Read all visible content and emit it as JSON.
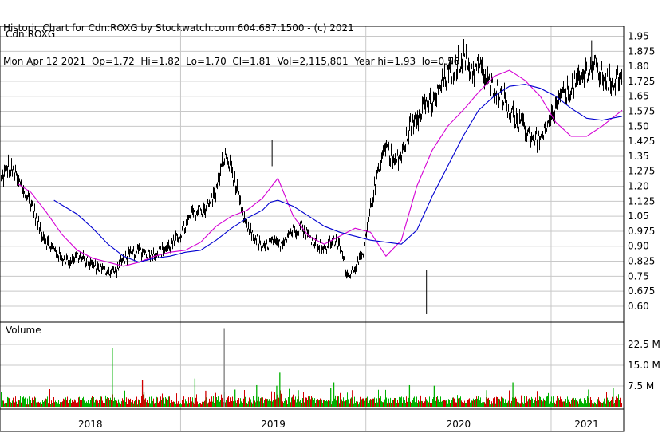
{
  "header": {
    "line1": "Historic Chart for Cdn:ROXG by Stockwatch.com 604.687.1500 - (c) 2021",
    "line2": "Mon Apr 12 2021  Op=1.72  Hi=1.82  Lo=1.70  Cl=1.81  Vol=2,115,801  Year hi=1.93  lo=0.56"
  },
  "colors": {
    "price_bars": "#000000",
    "ma_short": "#d400d4",
    "ma_long": "#0000d0",
    "vol_up": "#00b000",
    "vol_down": "#d00000",
    "vol_spike": "#8c8c8c",
    "grid": "#c8c8c8"
  },
  "chart_data": [
    {
      "type": "line",
      "title": "Cdn:ROXG",
      "ylim": [
        0.52,
        2.0
      ],
      "y_ticks": [
        "1.95",
        "1.875",
        "1.80",
        "1.725",
        "1.65",
        "1.575",
        "1.50",
        "1.425",
        "1.35",
        "1.275",
        "1.20",
        "1.125",
        "1.05",
        "0.975",
        "0.90",
        "0.825",
        "0.75",
        "0.675",
        "0.60"
      ],
      "grid": true,
      "x_range_months": [
        0,
        40.3
      ],
      "series": [
        {
          "role": "daily price bars (high-low)",
          "x": [
            0,
            0.5,
            1,
            1.5,
            2,
            2.5,
            3,
            3.5,
            4,
            4.5,
            5,
            5.5,
            6,
            6.5,
            7,
            7.5,
            8,
            8.5,
            9,
            9.5,
            10,
            10.5,
            11,
            11.5,
            12,
            12.5,
            13,
            13.5,
            14,
            14.5,
            15,
            15.5,
            16,
            16.5,
            17,
            17.5,
            18,
            18.5,
            19,
            19.5,
            20,
            20.5,
            21,
            21.5,
            22,
            22.5,
            23,
            23.5,
            24,
            24.5,
            25,
            25.5,
            26,
            26.5,
            27,
            27.5,
            28,
            28.5,
            29,
            29.5,
            30,
            30.5,
            31,
            31.5,
            32,
            32.5,
            33,
            33.5,
            34,
            34.5,
            35,
            35.5,
            36,
            36.5,
            37,
            37.5,
            38,
            38.5,
            39,
            39.5,
            40,
            40.3
          ],
          "values": [
            1.22,
            1.3,
            1.25,
            1.18,
            1.12,
            1.0,
            0.92,
            0.88,
            0.84,
            0.83,
            0.85,
            0.83,
            0.8,
            0.79,
            0.77,
            0.78,
            0.84,
            0.86,
            0.88,
            0.86,
            0.86,
            0.88,
            0.9,
            0.94,
            1.0,
            1.07,
            1.08,
            1.1,
            1.18,
            1.35,
            1.28,
            1.12,
            0.98,
            0.95,
            0.88,
            0.92,
            0.9,
            0.95,
            0.98,
            1.0,
            0.95,
            0.92,
            0.88,
            0.93,
            0.9,
            0.75,
            0.8,
            0.85,
            1.1,
            1.3,
            1.4,
            1.32,
            1.35,
            1.5,
            1.55,
            1.62,
            1.6,
            1.7,
            1.75,
            1.8,
            1.85,
            1.78,
            1.8,
            1.72,
            1.7,
            1.66,
            1.58,
            1.52,
            1.48,
            1.45,
            1.42,
            1.5,
            1.6,
            1.65,
            1.7,
            1.72,
            1.78,
            1.8,
            1.75,
            1.72,
            1.74,
            1.81
          ]
        },
        {
          "role": "moving average (short)",
          "x": [
            1.2,
            2,
            3,
            4,
            5,
            6,
            7,
            8,
            9,
            10,
            11,
            12,
            13,
            14,
            15,
            16,
            17,
            18,
            19,
            20,
            21,
            22,
            23,
            24,
            25,
            26,
            27,
            28,
            29,
            30,
            31,
            32,
            33,
            34,
            35,
            36,
            37,
            38,
            39,
            40.3
          ],
          "values": [
            1.21,
            1.17,
            1.07,
            0.96,
            0.88,
            0.84,
            0.82,
            0.8,
            0.82,
            0.85,
            0.87,
            0.88,
            0.92,
            1.0,
            1.05,
            1.08,
            1.14,
            1.24,
            1.05,
            0.95,
            0.91,
            0.95,
            0.99,
            0.97,
            0.85,
            0.93,
            1.2,
            1.38,
            1.5,
            1.58,
            1.67,
            1.75,
            1.78,
            1.73,
            1.65,
            1.52,
            1.45,
            1.45,
            1.5,
            1.58
          ]
        },
        {
          "role": "moving average (long)",
          "x": [
            3.5,
            5,
            6,
            7,
            8,
            9,
            10,
            11,
            12,
            13,
            14,
            15,
            16,
            17,
            17.5,
            18,
            19,
            20,
            21,
            22,
            23,
            24,
            25,
            26,
            27,
            28,
            29,
            30,
            31,
            32,
            33,
            34,
            35,
            36,
            37,
            38,
            39,
            40.3
          ],
          "values": [
            1.13,
            1.06,
            0.99,
            0.91,
            0.85,
            0.82,
            0.84,
            0.85,
            0.87,
            0.88,
            0.93,
            0.99,
            1.04,
            1.08,
            1.12,
            1.13,
            1.1,
            1.05,
            1.0,
            0.97,
            0.95,
            0.93,
            0.92,
            0.91,
            0.98,
            1.15,
            1.3,
            1.45,
            1.58,
            1.65,
            1.7,
            1.71,
            1.69,
            1.65,
            1.59,
            1.54,
            1.53,
            1.55
          ]
        }
      ]
    },
    {
      "type": "bar",
      "title": "Volume",
      "ylim": [
        0,
        30
      ],
      "y_ticks": [
        "22.5 M",
        "15.0 M",
        "7.5 M"
      ],
      "x_labels": [
        "2018",
        "2019",
        "2020",
        "2021"
      ],
      "spikes": [
        {
          "x": 7.25,
          "value": 21.2,
          "tone": "up"
        },
        {
          "x": 9.2,
          "value": 9.8,
          "tone": "down"
        },
        {
          "x": 9.3,
          "value": 5.5,
          "tone": "up"
        },
        {
          "x": 12.6,
          "value": 10.2,
          "tone": "up"
        },
        {
          "x": 13.3,
          "value": 5.8,
          "tone": "down"
        },
        {
          "x": 15.2,
          "value": 6.2,
          "tone": "up"
        },
        {
          "x": 16.6,
          "value": 7.8,
          "tone": "up"
        },
        {
          "x": 17.9,
          "value": 7.6,
          "tone": "up"
        },
        {
          "x": 18.1,
          "value": 12.3,
          "tone": "up"
        },
        {
          "x": 19.3,
          "value": 6.0,
          "tone": "up"
        },
        {
          "x": 21.4,
          "value": 6.9,
          "tone": "up"
        },
        {
          "x": 21.6,
          "value": 8.8,
          "tone": "up"
        },
        {
          "x": 22.8,
          "value": 6.0,
          "tone": "down"
        },
        {
          "x": 26.5,
          "value": 7.8,
          "tone": "up"
        },
        {
          "x": 28.1,
          "value": 7.6,
          "tone": "up"
        },
        {
          "x": 31.5,
          "value": 6.0,
          "tone": "up"
        },
        {
          "x": 33.2,
          "value": 8.8,
          "tone": "up"
        },
        {
          "x": 38.1,
          "value": 6.2,
          "tone": "up"
        },
        {
          "x": 39.7,
          "value": 6.8,
          "tone": "up"
        }
      ],
      "gray_spike": {
        "x": 14.5,
        "value": 28.4
      }
    }
  ]
}
